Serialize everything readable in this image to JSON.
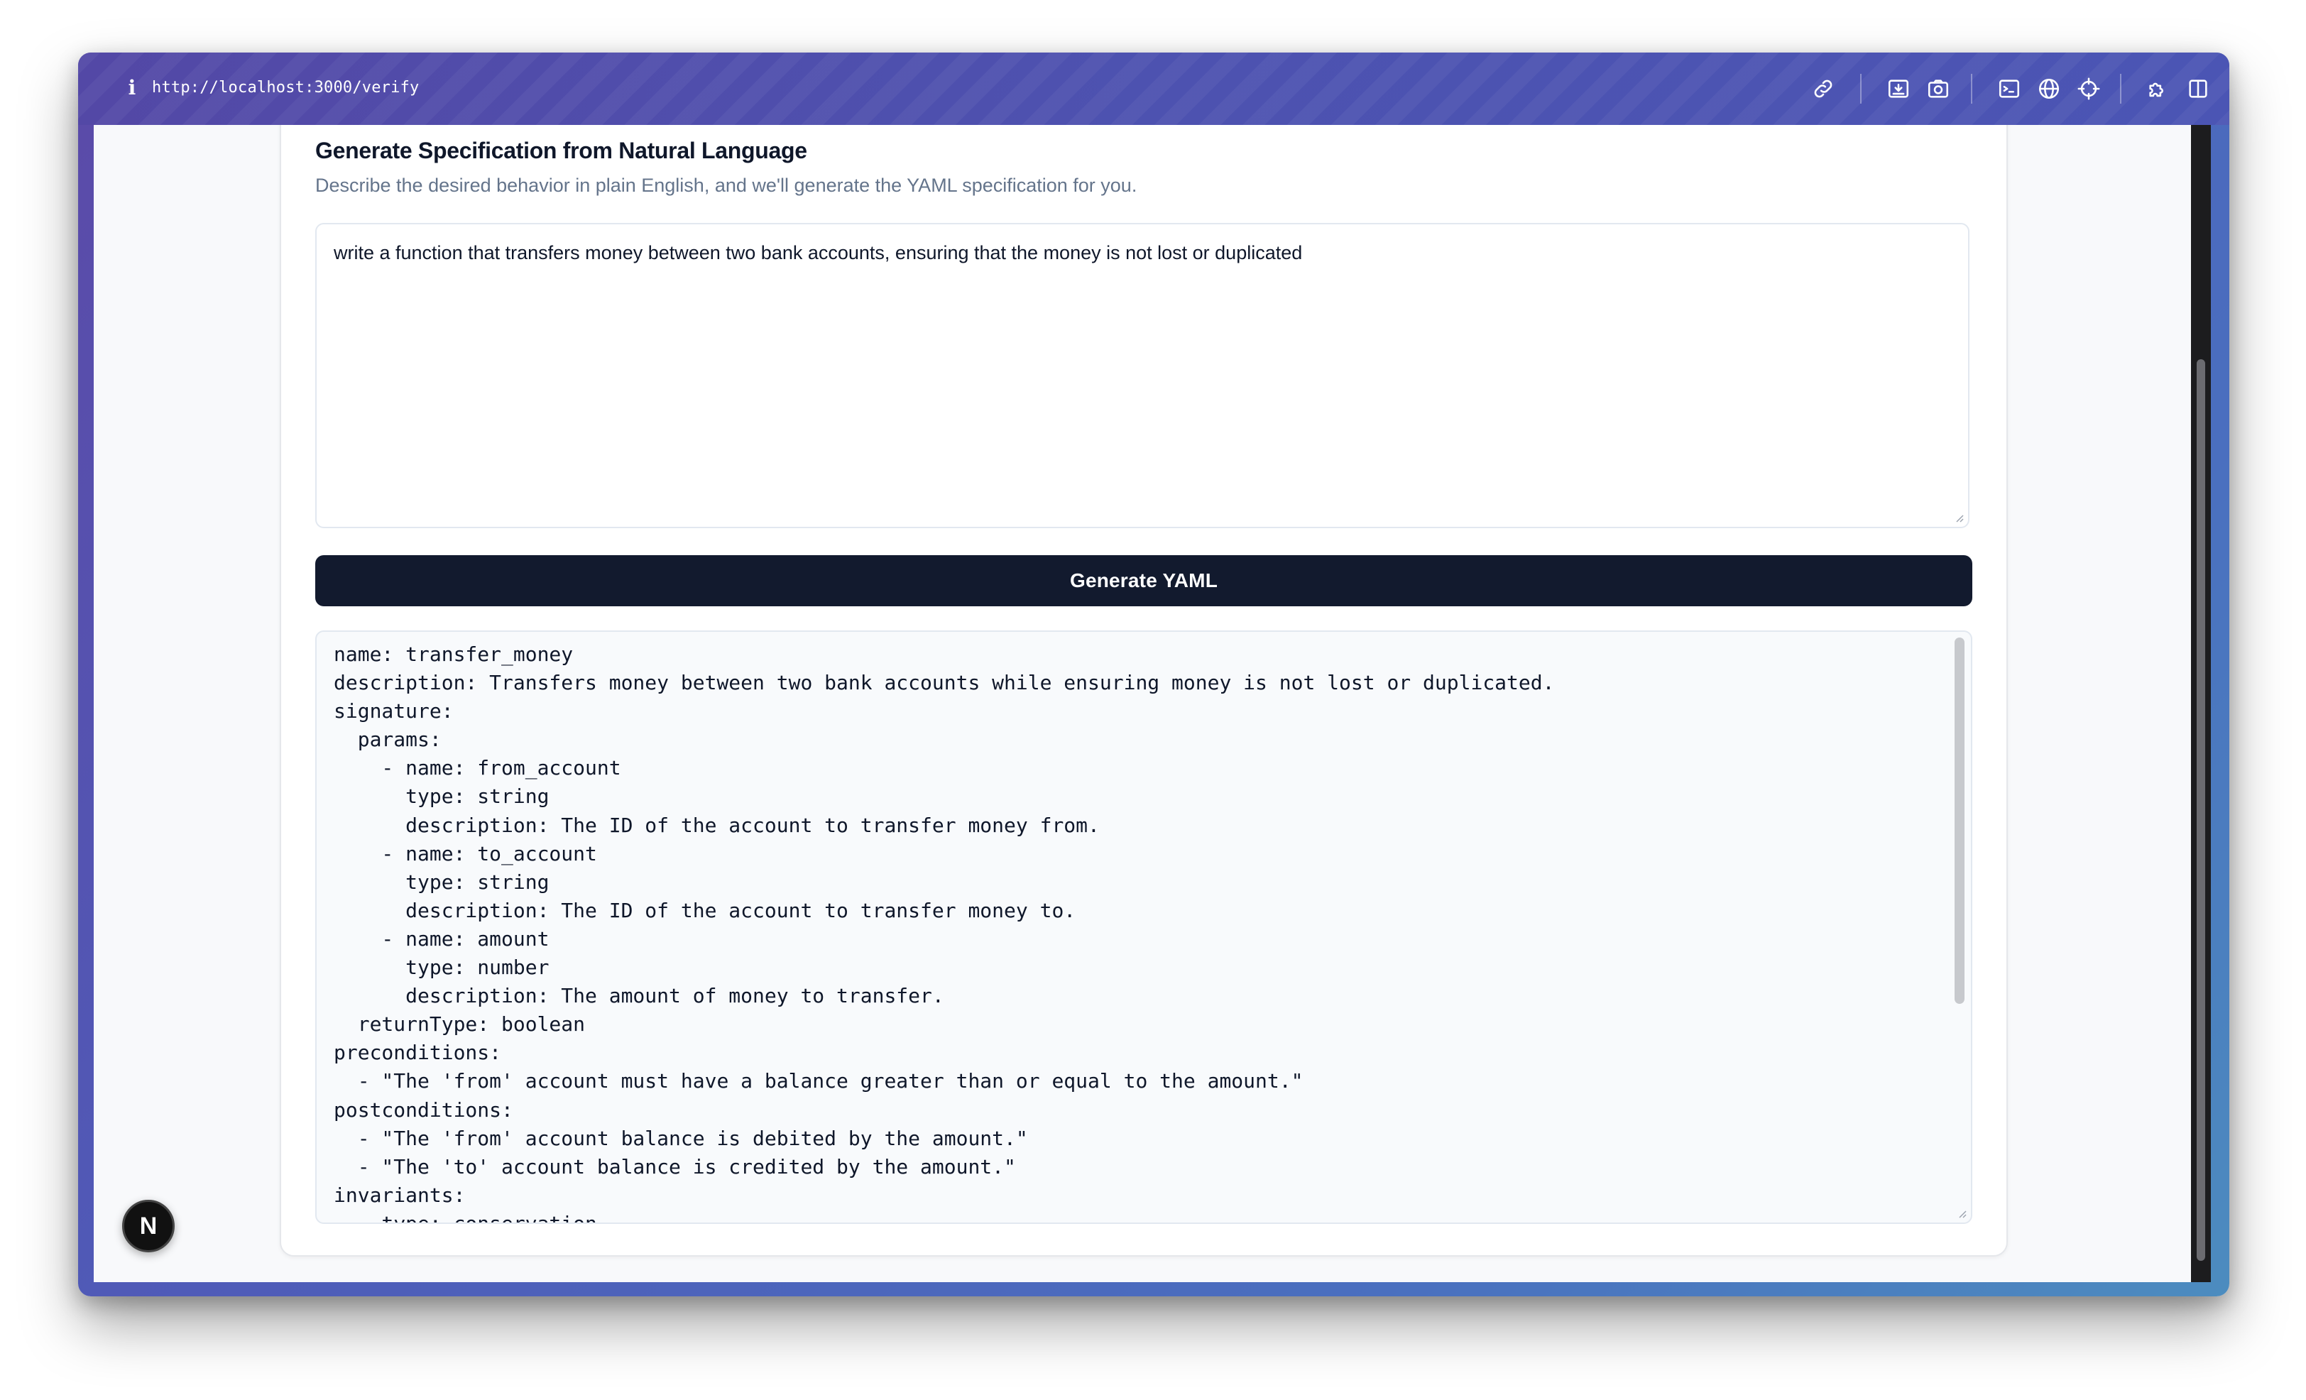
{
  "browser": {
    "url": "http://localhost:3000/verify",
    "info_icon": "info-icon",
    "toolbar_icons": [
      "link-icon",
      "download-icon",
      "camera-icon",
      "terminal-icon",
      "globe-icon",
      "crosshair-icon",
      "puzzle-icon",
      "split-view-icon"
    ]
  },
  "card": {
    "title": "Generate Specification from Natural Language",
    "subtitle": "Describe the desired behavior in plain English, and we'll generate the YAML specification for you."
  },
  "prompt": {
    "value": "write a function that transfers money between two bank accounts, ensuring that the money is not lost or duplicated"
  },
  "actions": {
    "generate_label": "Generate YAML"
  },
  "yaml": {
    "content": "name: transfer_money\ndescription: Transfers money between two bank accounts while ensuring money is not lost or duplicated.\nsignature:\n  params:\n    - name: from_account\n      type: string\n      description: The ID of the account to transfer money from.\n    - name: to_account\n      type: string\n      description: The ID of the account to transfer money to.\n    - name: amount\n      type: number\n      description: The amount of money to transfer.\n  returnType: boolean\npreconditions:\n  - \"The 'from' account must have a balance greater than or equal to the amount.\"\npostconditions:\n  - \"The 'from' account balance is debited by the amount.\"\n  - \"The 'to' account balance is credited by the amount.\"\ninvariants:\n  - type: conservation"
  },
  "badge": {
    "letter": "N"
  },
  "colors": {
    "button_bg": "#121a2e",
    "frame_gradient_start": "#5b4aa8",
    "frame_gradient_end": "#4c8cbf"
  }
}
